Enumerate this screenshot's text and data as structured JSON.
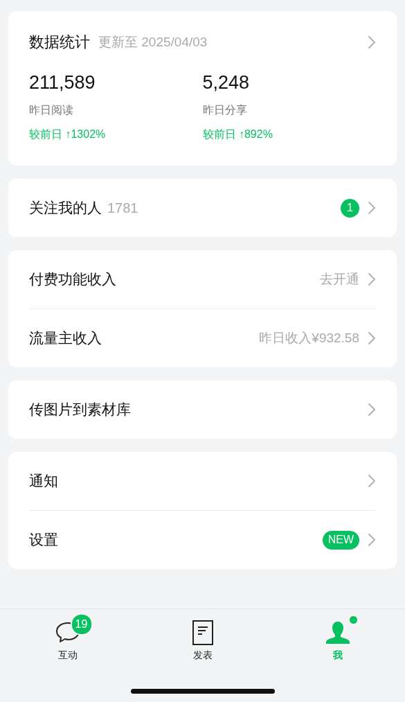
{
  "stats": {
    "title": "数据统计",
    "updated": "更新至 2025/04/03",
    "items": [
      {
        "value": "211,589",
        "label": "昨日阅读",
        "change": "较前日 ↑1302%"
      },
      {
        "value": "5,248",
        "label": "昨日分享",
        "change": "较前日 ↑892%"
      }
    ]
  },
  "groups": [
    {
      "rows": [
        {
          "label": "关注我的人",
          "count": "1781",
          "badge": {
            "kind": "count",
            "text": "1"
          }
        }
      ]
    },
    {
      "rows": [
        {
          "label": "付费功能收入",
          "value": "去开通"
        },
        {
          "label": "流量主收入",
          "value": "昨日收入¥932.58"
        }
      ]
    },
    {
      "rows": [
        {
          "label": "传图片到素材库"
        }
      ]
    },
    {
      "rows": [
        {
          "label": "通知"
        },
        {
          "label": "设置",
          "badge": {
            "kind": "new",
            "text": "NEW"
          }
        }
      ]
    }
  ],
  "tabs": [
    {
      "kind": "chat",
      "label": "互动",
      "badge": "19",
      "dot": false,
      "selected": false
    },
    {
      "kind": "compose",
      "label": "发表",
      "dot": false,
      "selected": false
    },
    {
      "kind": "profile",
      "label": "我",
      "dot": true,
      "selected": true
    }
  ]
}
